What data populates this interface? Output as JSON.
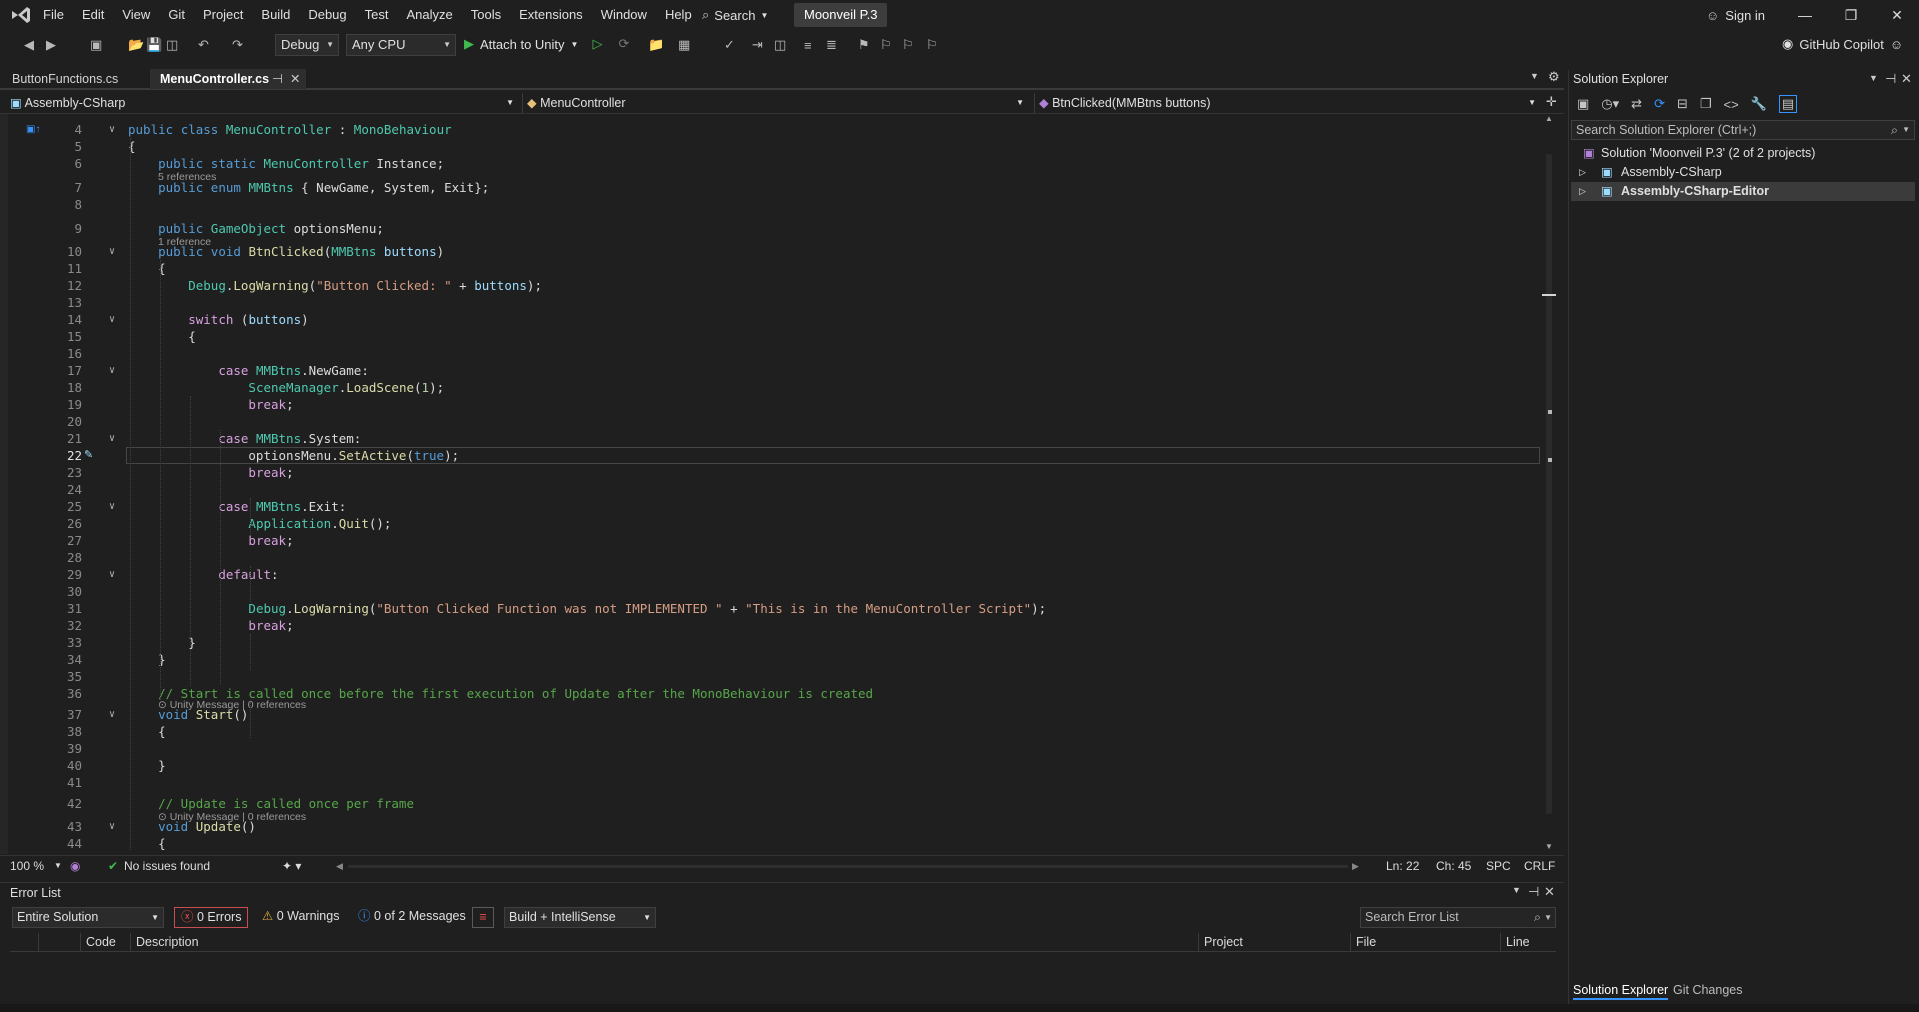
{
  "menubar": {
    "items": [
      "File",
      "Edit",
      "View",
      "Git",
      "Project",
      "Build",
      "Debug",
      "Test",
      "Analyze",
      "Tools",
      "Extensions",
      "Window",
      "Help"
    ],
    "search_label": "Search",
    "solution_name": "Moonveil P.3",
    "sign_in": "Sign in"
  },
  "toolbar": {
    "config": "Debug",
    "platform": "Any CPU",
    "attach": "Attach to Unity",
    "copilot": "GitHub Copilot"
  },
  "tabs": [
    {
      "label": "ButtonFunctions.cs",
      "active": false
    },
    {
      "label": "MenuController.cs",
      "active": true
    }
  ],
  "navbar": {
    "project": "Assembly-CSharp",
    "type": "MenuController",
    "member": "BtnClicked(MMBtns buttons)"
  },
  "code_lines": [
    {
      "n": "4",
      "html": "<span class=\"k\">public</span> <span class=\"k\">class</span> <span class=\"t\">MenuController</span> : <span class=\"t\">MonoBehaviour</span>"
    },
    {
      "n": "5",
      "html": "{"
    },
    {
      "n": "6",
      "html": "    <span class=\"k\">public</span> <span class=\"k\">static</span> <span class=\"t\">MenuController</span> Instance;"
    },
    {
      "n": "7",
      "html": "    <span class=\"k\">public</span> <span class=\"k\">enum</span> <span class=\"t\">MMBtns</span> { NewGame, System, Exit};"
    },
    {
      "n": "8",
      "html": ""
    },
    {
      "n": "9",
      "html": "    <span class=\"k\">public</span> <span class=\"t\">GameObject</span> optionsMenu;"
    },
    {
      "n": "10",
      "html": "    <span class=\"k\">public</span> <span class=\"k\">void</span> <span class=\"m\">BtnClicked</span>(<span class=\"t\">MMBtns</span> <span class=\"p\">buttons</span>)"
    },
    {
      "n": "11",
      "html": "    {"
    },
    {
      "n": "12",
      "html": "        <span class=\"t\">Debug</span>.<span class=\"m\">LogWarning</span>(<span class=\"s\">\"Button Clicked: \"</span> + <span class=\"p\">buttons</span>);"
    },
    {
      "n": "13",
      "html": ""
    },
    {
      "n": "14",
      "html": "        <span class=\"ck\">switch</span> (<span class=\"p\">buttons</span>)"
    },
    {
      "n": "15",
      "html": "        {"
    },
    {
      "n": "16",
      "html": ""
    },
    {
      "n": "17",
      "html": "            <span class=\"ck\">case</span> <span class=\"t\">MMBtns</span>.NewGame:"
    },
    {
      "n": "18",
      "html": "                <span class=\"t\">SceneManager</span>.<span class=\"m\">LoadScene</span>(<span class=\"n\">1</span>);"
    },
    {
      "n": "19",
      "html": "                <span class=\"ck\">break</span>;"
    },
    {
      "n": "20",
      "html": ""
    },
    {
      "n": "21",
      "html": "            <span class=\"ck\">case</span> <span class=\"t\">MMBtns</span>.System:"
    },
    {
      "n": "22",
      "html": "                optionsMenu.<span class=\"m\">SetActive</span>(<span class=\"k\">true</span>);"
    },
    {
      "n": "23",
      "html": "                <span class=\"ck\">break</span>;"
    },
    {
      "n": "24",
      "html": ""
    },
    {
      "n": "25",
      "html": "            <span class=\"ck\">case</span> <span class=\"t\">MMBtns</span>.Exit:"
    },
    {
      "n": "26",
      "html": "                <span class=\"t\">Application</span>.<span class=\"m\">Quit</span>();"
    },
    {
      "n": "27",
      "html": "                <span class=\"ck\">break</span>;"
    },
    {
      "n": "28",
      "html": ""
    },
    {
      "n": "29",
      "html": "            <span class=\"ck\">default</span>:"
    },
    {
      "n": "30",
      "html": ""
    },
    {
      "n": "31",
      "html": "                <span class=\"t\">Debug</span>.<span class=\"m\">LogWarning</span>(<span class=\"s\">\"Button Clicked Function was not IMPLEMENTED \"</span> + <span class=\"s\">\"This is in the MenuController Script\"</span>);"
    },
    {
      "n": "32",
      "html": "                <span class=\"ck\">break</span>;"
    },
    {
      "n": "33",
      "html": "        }"
    },
    {
      "n": "34",
      "html": "    }"
    },
    {
      "n": "35",
      "html": ""
    },
    {
      "n": "36",
      "html": "    <span class=\"c\">// Start is called once before the first execution of Update after the MonoBehaviour is created</span>"
    },
    {
      "n": "37",
      "html": "    <span class=\"k\">void</span> <span class=\"m\">Start</span>()"
    },
    {
      "n": "38",
      "html": "    {"
    },
    {
      "n": "39",
      "html": ""
    },
    {
      "n": "40",
      "html": "    }"
    },
    {
      "n": "41",
      "html": ""
    },
    {
      "n": "42",
      "html": "    <span class=\"c\">// Update is called once per frame</span>"
    },
    {
      "n": "43",
      "html": "    <span class=\"k\">void</span> <span class=\"m\">Update</span>()"
    },
    {
      "n": "44",
      "html": "    {"
    }
  ],
  "codelens": {
    "instance_refs": "5 references",
    "options_refs": "1 reference",
    "start_lens": "⊙ Unity Message | 0 references",
    "update_lens": "⊙ Unity Message | 0 references"
  },
  "editor_status": {
    "zoom": "100 %",
    "issues": "No issues found",
    "ln": "Ln: 22",
    "ch": "Ch: 45",
    "spc": "SPC",
    "eol": "CRLF"
  },
  "error_list": {
    "title": "Error List",
    "scope": "Entire Solution",
    "errors": "0 Errors",
    "warnings": "0 Warnings",
    "messages": "0 of 2 Messages",
    "build_filter": "Build + IntelliSense",
    "search_placeholder": "Search Error List",
    "columns": [
      "Code",
      "Description",
      "Project",
      "File",
      "Line"
    ]
  },
  "solution_explorer": {
    "title": "Solution Explorer",
    "search_placeholder": "Search Solution Explorer (Ctrl+;)",
    "solution": "Solution 'Moonveil P.3' (2 of 2 projects)",
    "projects": [
      "Assembly-CSharp",
      "Assembly-CSharp-Editor"
    ],
    "bottom_tabs": [
      "Solution Explorer",
      "Git Changes"
    ]
  }
}
